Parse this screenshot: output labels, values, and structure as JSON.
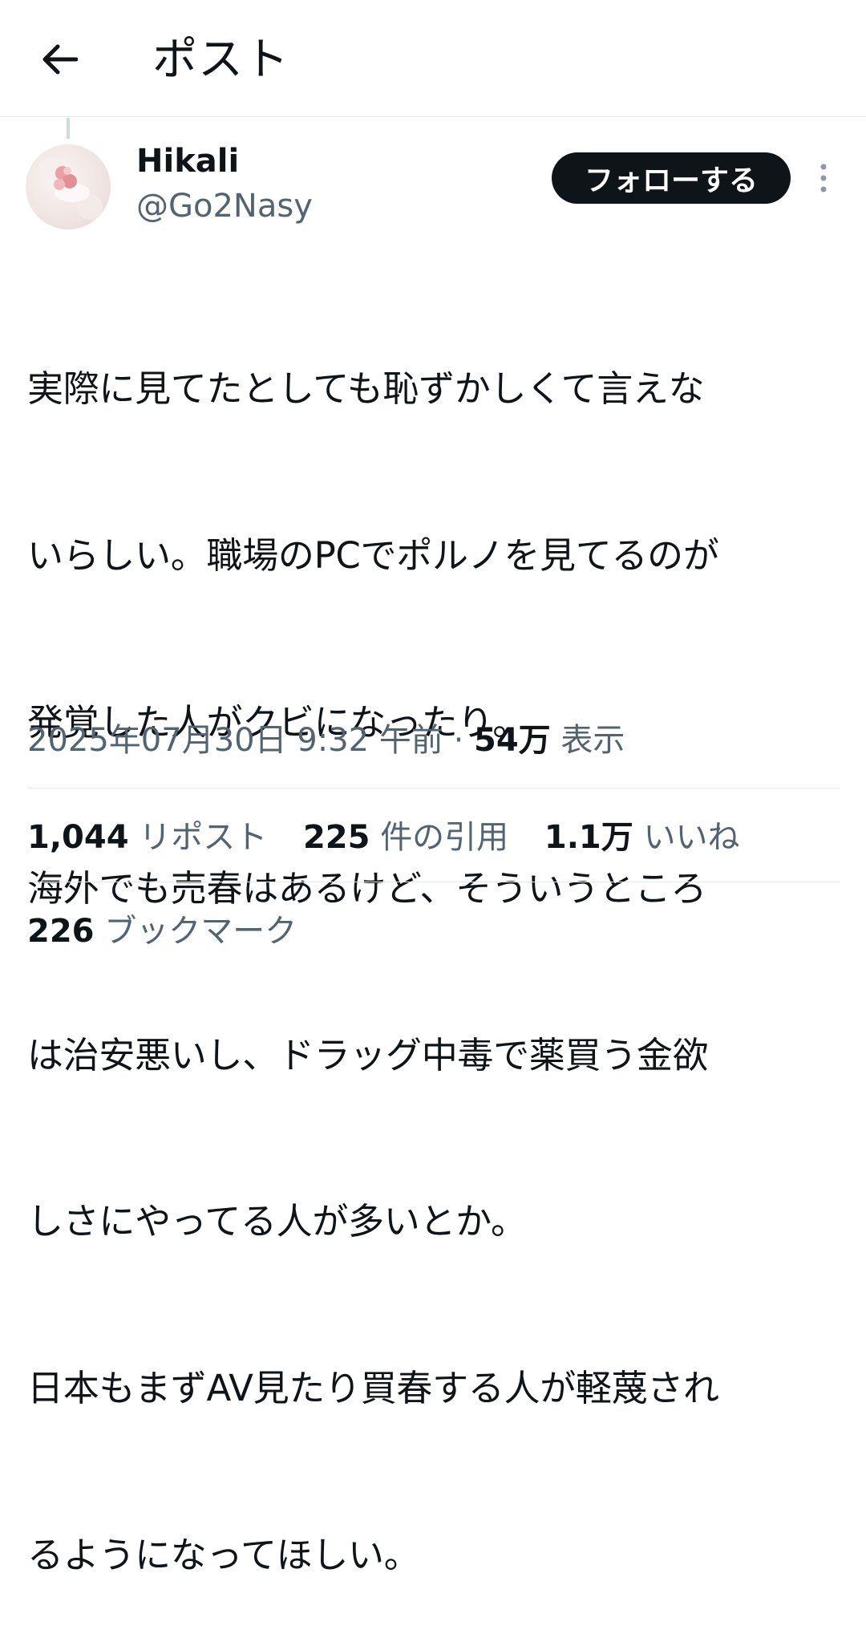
{
  "header": {
    "title": "ポスト",
    "back_icon": "arrow-left-icon"
  },
  "author": {
    "display_name": "Hikali",
    "handle": "@Go2Nasy",
    "follow_label": "フォローする",
    "more_icon": "more-vertical-icon"
  },
  "tweet": {
    "lines": [
      "実際に見てたとしても恥ずかしくて言えな",
      "いらしい。職場のPCでポルノを見てるのが",
      "発覚した人がクビになったり。",
      "海外でも売春はあるけど、そういうところ",
      "は治安悪いし、ドラッグ中毒で薬買う金欲",
      "しさにやってる人が多いとか。",
      "日本もまずAV見たり買春する人が軽蔑され",
      "るようになってほしい。"
    ],
    "timestamp": "2025年07月30日 9:32 午前",
    "separator": "·",
    "views_count": "54万",
    "views_label": "表示"
  },
  "stats": {
    "reposts_count": "1,044",
    "reposts_label": "リポスト",
    "quotes_count": "225",
    "quotes_label": "件の引用",
    "likes_count": "1.1万",
    "likes_label": "いいね",
    "bookmarks_count": "226",
    "bookmarks_label": "ブックマーク"
  },
  "colors": {
    "text": "#0f1419",
    "secondary": "#536471",
    "divider": "#e6e8ea",
    "button_bg": "#0f1419"
  }
}
